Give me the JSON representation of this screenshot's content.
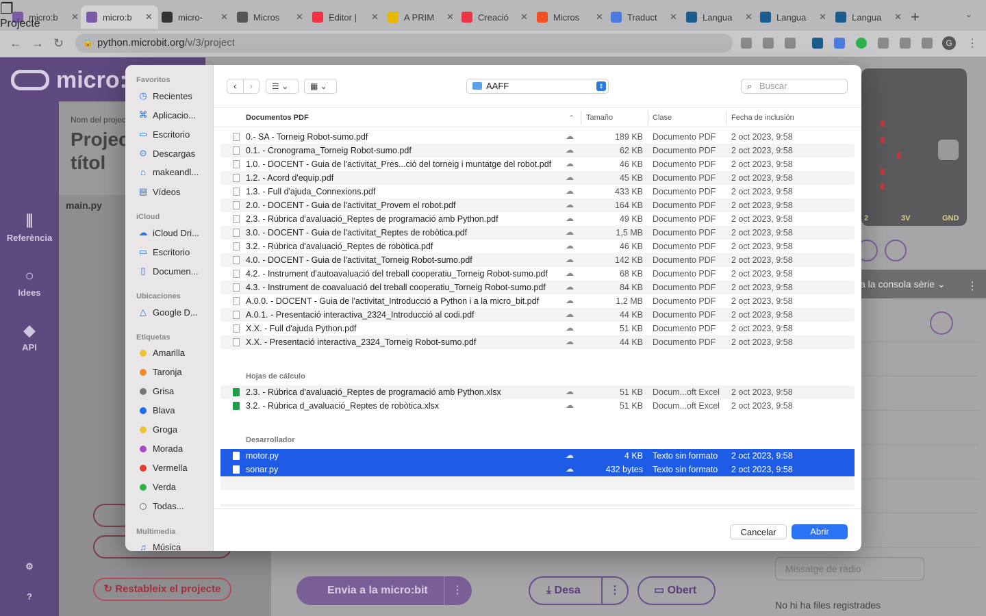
{
  "browser": {
    "tabs": [
      {
        "label": "micro:b",
        "color": "#7a5aa6"
      },
      {
        "label": "micro:b",
        "color": "#7a5aa6"
      },
      {
        "label": "micro-",
        "color": "#333333"
      },
      {
        "label": "Micros",
        "color": "#555555"
      },
      {
        "label": "Editor |",
        "color": "#e34"
      },
      {
        "label": "A PRIM",
        "color": "#e6b800"
      },
      {
        "label": "Creació",
        "color": "#e34"
      },
      {
        "label": "Micros",
        "color": "#f25022"
      },
      {
        "label": "Traduct",
        "color": "#4a7ce0"
      },
      {
        "label": "Langua",
        "color": "#1a5d8e"
      },
      {
        "label": "Langua",
        "color": "#1a5d8e"
      },
      {
        "label": "Langua",
        "color": "#1a5d8e"
      }
    ],
    "url_host": "python.microbit.org",
    "url_path": "/v/3/project",
    "avatar": "G"
  },
  "app": {
    "brand": "micro:",
    "nav": [
      {
        "label": "Referència",
        "icon": "library-icon"
      },
      {
        "label": "Idees",
        "icon": "lightbulb-icon"
      },
      {
        "label": "API",
        "icon": "python-icon"
      },
      {
        "label": "Projecte",
        "icon": "files-icon"
      }
    ],
    "project_label": "Nom del projec",
    "project_title_1": "Projec",
    "project_title_2": "títol",
    "file": "main.py",
    "reset": "Restableix el projecte",
    "send": "Envia a la micro:bit",
    "more": "⋮",
    "save": "Desa",
    "open": "Obert",
    "console": "a la consola sèrie",
    "radio_placeholder": "Missatge de ràdio",
    "no_files": "No hi ha files registrades",
    "pins": [
      "2",
      "3V",
      "GND"
    ]
  },
  "dialog": {
    "sidebar": {
      "favorites_title": "Favoritos",
      "favorites": [
        {
          "label": "Recientes",
          "icon": "clock-icon"
        },
        {
          "label": "Aplicacio...",
          "icon": "apps-icon"
        },
        {
          "label": "Escritorio",
          "icon": "desktop-icon"
        },
        {
          "label": "Descargas",
          "icon": "download-icon"
        },
        {
          "label": "makeandl...",
          "icon": "home-icon"
        },
        {
          "label": "Vídeos",
          "icon": "film-icon"
        }
      ],
      "icloud_title": "iCloud",
      "icloud": [
        {
          "label": "iCloud Dri...",
          "icon": "cloud-icon"
        },
        {
          "label": "Escritorio",
          "icon": "desktop-icon"
        },
        {
          "label": "Documen...",
          "icon": "document-icon"
        }
      ],
      "locations_title": "Ubicaciones",
      "locations": [
        {
          "label": "Google D...",
          "icon": "drive-icon"
        }
      ],
      "tags_title": "Etiquetas",
      "tags": [
        {
          "label": "Amarilla",
          "color": "#f2c12e"
        },
        {
          "label": "Taronja",
          "color": "#f08a24"
        },
        {
          "label": "Grisa",
          "color": "#777777"
        },
        {
          "label": "Blava",
          "color": "#1a6ef0"
        },
        {
          "label": "Groga",
          "color": "#f2c12e"
        },
        {
          "label": "Morada",
          "color": "#a64bc9"
        },
        {
          "label": "Vermella",
          "color": "#e8392f"
        },
        {
          "label": "Verda",
          "color": "#2db34a"
        },
        {
          "label": "Todas...",
          "color": ""
        }
      ],
      "media_title": "Multimedia",
      "media": [
        {
          "label": "Música",
          "icon": "music-icon"
        }
      ]
    },
    "location": "AAFF",
    "search_placeholder": "Buscar",
    "columns": {
      "name": "Documentos PDF",
      "size": "Tamaño",
      "kind": "Clase",
      "date": "Fecha de inclusión"
    },
    "pdf_files": [
      {
        "name": "0.- SA - Torneig  Robot-sumo.pdf",
        "size": "189 KB",
        "kind": "Documento PDF",
        "date": "2 oct 2023, 9:58"
      },
      {
        "name": "0.1. - Cronograma_Torneig Robot-sumo.pdf",
        "size": "62 KB",
        "kind": "Documento PDF",
        "date": "2 oct 2023, 9:58"
      },
      {
        "name": "1.0. - DOCENT - Guia de l'activitat_Pres...ció del torneig i muntatge del robot.pdf",
        "size": "46 KB",
        "kind": "Documento PDF",
        "date": "2 oct 2023, 9:58"
      },
      {
        "name": "1.2. - Acord d'equip.pdf",
        "size": "45 KB",
        "kind": "Documento PDF",
        "date": "2 oct 2023, 9:58"
      },
      {
        "name": "1.3. - Full d'ajuda_Connexions.pdf",
        "size": "433 KB",
        "kind": "Documento PDF",
        "date": "2 oct 2023, 9:58"
      },
      {
        "name": "2.0. - DOCENT - Guia de l'activitat_Provem el robot.pdf",
        "size": "164 KB",
        "kind": "Documento PDF",
        "date": "2 oct 2023, 9:58"
      },
      {
        "name": "2.3. - Rúbrica d'avaluació_Reptes de programació amb Python.pdf",
        "size": "49 KB",
        "kind": "Documento PDF",
        "date": "2 oct 2023, 9:58"
      },
      {
        "name": "3.0. - DOCENT - Guia de l'activitat_Reptes de robòtica.pdf",
        "size": "1,5 MB",
        "kind": "Documento PDF",
        "date": "2 oct 2023, 9:58"
      },
      {
        "name": "3.2. - Rúbrica d'avaluació_Reptes de robòtica.pdf",
        "size": "46 KB",
        "kind": "Documento PDF",
        "date": "2 oct 2023, 9:58"
      },
      {
        "name": "4.0. - DOCENT - Guia de l'activitat_Torneig Robot-sumo.pdf",
        "size": "142 KB",
        "kind": "Documento PDF",
        "date": "2 oct 2023, 9:58"
      },
      {
        "name": "4.2. -  Instrument d'autoavaluació del treball cooperatiu_Torneig Robot-sumo.pdf",
        "size": "68 KB",
        "kind": "Documento PDF",
        "date": "2 oct 2023, 9:58"
      },
      {
        "name": "4.3. -  Instrument de coavaluació del treball cooperatiu_Torneig Robot-sumo.pdf",
        "size": "84 KB",
        "kind": "Documento PDF",
        "date": "2 oct 2023, 9:58"
      },
      {
        "name": "A.0.0. - DOCENT - Guia de l'activitat_Introducció a Python i a la micro_bit.pdf",
        "size": "1,2 MB",
        "kind": "Documento PDF",
        "date": "2 oct 2023, 9:58"
      },
      {
        "name": "A.0.1. - Presentació interactiva_2324_Introducció al codi.pdf",
        "size": "44 KB",
        "kind": "Documento PDF",
        "date": "2 oct 2023, 9:58"
      },
      {
        "name": "X.X. - Full d'ajuda Python.pdf",
        "size": "51 KB",
        "kind": "Documento PDF",
        "date": "2 oct 2023, 9:58"
      },
      {
        "name": "X.X. - Presentació interactiva_2324_Torneig Robot-sumo.pdf",
        "size": "44 KB",
        "kind": "Documento PDF",
        "date": "2 oct 2023, 9:58"
      }
    ],
    "sheets_title": "Hojas de cálculo",
    "sheet_files": [
      {
        "name": "2.3. - Rúbrica d'avaluació_Reptes de programació amb Python.xlsx",
        "size": "51 KB",
        "kind": "Docum...oft Excel",
        "date": "2 oct 2023, 9:58"
      },
      {
        "name": "3.2. - Rúbrica d_avaluació_Reptes de robòtica.xlsx",
        "size": "51 KB",
        "kind": "Docum...oft Excel",
        "date": "2 oct 2023, 9:58"
      }
    ],
    "dev_title": "Desarrollador",
    "dev_files": [
      {
        "name": "motor.py",
        "size": "4 KB",
        "kind": "Texto sin formato",
        "date": "2 oct 2023, 9:58"
      },
      {
        "name": "sonar.py",
        "size": "432 bytes",
        "kind": "Texto sin formato",
        "date": "2 oct 2023, 9:58"
      }
    ],
    "cancel": "Cancelar",
    "open": "Abrir"
  }
}
